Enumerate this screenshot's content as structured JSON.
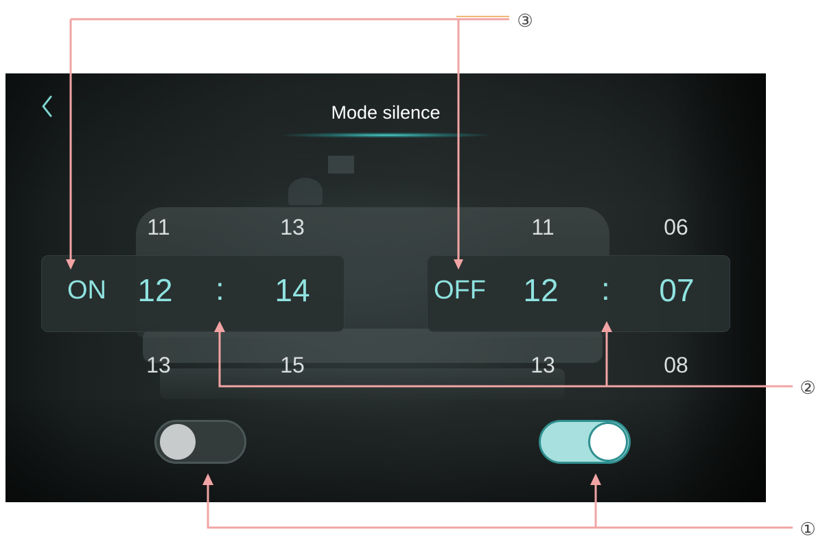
{
  "screen": {
    "title": "Mode silence",
    "back_icon": "chevron-left-icon",
    "accent_color": "#8fe3e0",
    "background_color": "#2a3131"
  },
  "schedule_on": {
    "label": "ON",
    "hour": {
      "prev": "11",
      "current": "12",
      "next": "13"
    },
    "minute": {
      "prev": "13",
      "current": "14",
      "next": "15"
    },
    "separator": ":"
  },
  "schedule_off": {
    "label": "OFF",
    "hour": {
      "prev": "11",
      "current": "12",
      "next": "13"
    },
    "minute": {
      "prev": "06",
      "current": "07",
      "next": "08"
    },
    "separator": ":"
  },
  "toggles": {
    "left": {
      "state": "off"
    },
    "right": {
      "state": "on"
    }
  },
  "annotations": {
    "callout_1": "①",
    "callout_2": "②",
    "callout_3": "③",
    "line_color": "#f2a4a4"
  }
}
